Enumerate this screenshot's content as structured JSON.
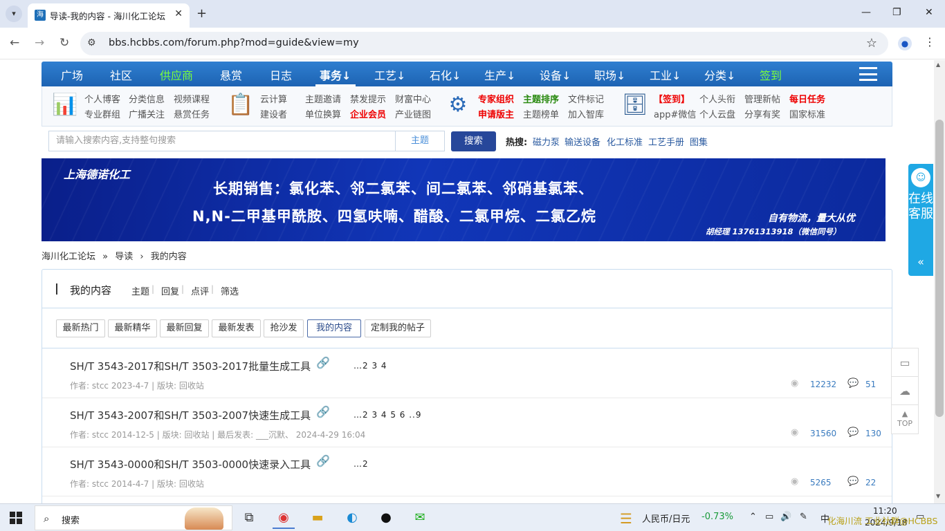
{
  "browser": {
    "tab_title": "导读-我的内容 - 海川化工论坛",
    "url": "bbs.hcbbs.com/forum.php?mod=guide&view=my",
    "icons": {
      "tab_menu": "chevron-down-icon",
      "favicon": "site-favicon",
      "close": "close-icon",
      "new_tab": "plus-icon",
      "back": "back-icon",
      "forward": "forward-icon",
      "reload": "reload-icon",
      "site_info": "tune-icon",
      "bookmark": "star-icon",
      "profile": "profile-icon",
      "menu": "kebab-icon"
    }
  },
  "nav": {
    "items": [
      "广场",
      "社区",
      "供应商",
      "悬赏",
      "日志",
      "事务↓",
      "工艺↓",
      "石化↓",
      "生产↓",
      "设备↓",
      "职场↓",
      "工业↓",
      "分类↓",
      "签到"
    ]
  },
  "subnav": {
    "g1": [
      "个人博客",
      "分类信息",
      "视频课程",
      "专业群组",
      "广播关注",
      "悬赏任务"
    ],
    "g2": [
      "云计算",
      "主题邀请",
      "禁发提示",
      "财富中心",
      "建设者",
      "单位换算",
      "企业会员",
      "产业链图"
    ],
    "g3": [
      "专家组织",
      "主题排序",
      "文件标记",
      "申请版主",
      "主题榜单",
      "加入智库"
    ],
    "g4": [
      "【签到】",
      "个人头衔",
      "管理新帖",
      "每日任务",
      "app#微信",
      "个人云盘",
      "分享有奖",
      "国家标准"
    ]
  },
  "search": {
    "placeholder": "请输入搜索内容,支持整句搜索",
    "type": "主题",
    "button": "搜索",
    "hot_label": "热搜:",
    "hot_items": [
      "磁力泵",
      "输送设备",
      "化工标准",
      "工艺手册",
      "图集"
    ]
  },
  "banner": {
    "company": "上海德诺化工",
    "line1": "长期销售：氯化苯、邻二氯苯、间二氯苯、邻硝基氯苯、",
    "line2": "N,N-二甲基甲酰胺、四氢呋喃、醋酸、二氯甲烷、二氯乙烷",
    "slogan": "自有物流，量大从优",
    "contact": "胡经理 13761313918（微信同号）"
  },
  "breadcrumb": [
    "海川化工论坛",
    "»",
    "导读",
    "›",
    "我的内容"
  ],
  "panel": {
    "title": "我的内容",
    "links": [
      "主题",
      "回复",
      "点评",
      "筛选"
    ],
    "filters": [
      "最新热门",
      "最新精华",
      "最新回复",
      "最新发表",
      "抢沙发",
      "我的内容",
      "定制我的帖子"
    ]
  },
  "threads": [
    {
      "title": "SH/T 3543-2017和SH/T 3503-2017批量生成工具",
      "pages": "…2 3 4",
      "meta": "作者: stcc   2023-4-7  |  版块: 回收站",
      "views": "12232",
      "replies": "51"
    },
    {
      "title": "SH/T 3543-2007和SH/T 3503-2007快速生成工具",
      "pages": "…2 3 4 5 6 ..9",
      "meta": "作者: stcc   2014-12-5  |  版块: 回收站  |  最后发表: ___沉默、   2024-4-29 16:04",
      "views": "31560",
      "replies": "130"
    },
    {
      "title": "SH/T 3543-0000和SH/T 3503-0000快速录入工具",
      "pages": "…2",
      "meta": "作者: stcc   2014-4-7  |  版块: 回收站",
      "views": "5265",
      "replies": "22"
    }
  ],
  "side_service": {
    "text": "在线客服",
    "arrow": "«"
  },
  "side_tools": {
    "top": "TOP"
  },
  "taskbar": {
    "search_text": "搜索",
    "currency": "人民币/日元",
    "change": "-0.73%",
    "ime": "中",
    "time": "11:20",
    "date": "2024/9/18",
    "watermark": "化海川流 工业社群@HCBBS"
  },
  "colors": {
    "nav_blue": "#1d63b3",
    "search_btn": "#27479a",
    "service_blue": "#1fa8e4",
    "link_blue": "#3a7bbf",
    "change_green": "#1a9a3a"
  }
}
